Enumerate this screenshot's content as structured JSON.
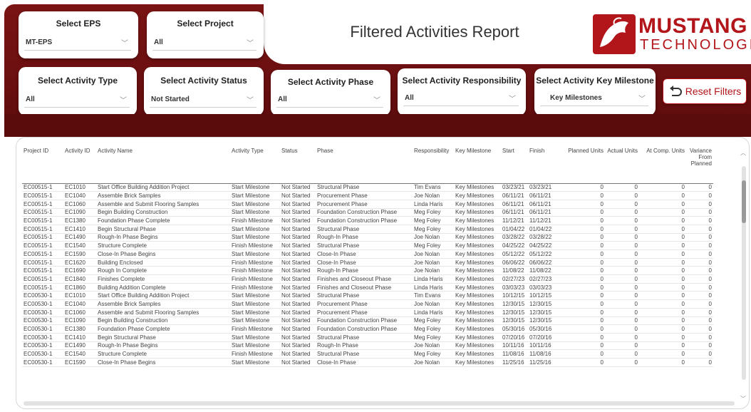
{
  "report_title": "Filtered Activities Report",
  "logo": {
    "brand": "MUSTANG",
    "sub": "TECHNOLOGIES"
  },
  "slicers": {
    "eps": {
      "title": "Select EPS",
      "value": "MT-EPS"
    },
    "project": {
      "title": "Select Project",
      "value": "All"
    },
    "activity_type": {
      "title": "Select Activity Type",
      "value": "All"
    },
    "activity_status": {
      "title": "Select Activity Status",
      "value": "Not Started"
    },
    "activity_phase": {
      "title": "Select Activity Phase",
      "value": "All"
    },
    "activity_responsibility": {
      "title": "Select Activity Responsibility",
      "value": "All"
    },
    "activity_key_milestone": {
      "title": "Select Activity Key Milestone",
      "value": "Key Milestones"
    }
  },
  "reset_label": "Reset Filters",
  "table": {
    "columns": [
      "Project ID",
      "Activity ID",
      "Activity Name",
      "Activity Type",
      "Status",
      "Phase",
      "Responsibility",
      "Key Milestone",
      "Start",
      "Finish",
      "Planned Units",
      "Actual Units",
      "At Comp. Units",
      "Variance From Planned"
    ],
    "rows": [
      [
        "EC00515-1",
        "EC1010",
        "Start Office Building Addition Project",
        "Start Milestone",
        "Not Started",
        "Structural Phase",
        "Tim Evans",
        "Key Milestones",
        "03/23/21",
        "03/23/21",
        "0",
        "0",
        "0",
        "0"
      ],
      [
        "EC00515-1",
        "EC1040",
        "Assemble Brick Samples",
        "Start Milestone",
        "Not Started",
        "Procurement Phase",
        "Joe Nolan",
        "Key Milestones",
        "06/11/21",
        "06/11/21",
        "0",
        "0",
        "0",
        "0"
      ],
      [
        "EC00515-1",
        "EC1060",
        "Assemble and Submit Flooring Samples",
        "Start Milestone",
        "Not Started",
        "Procurement Phase",
        "Linda Haris",
        "Key Milestones",
        "06/11/21",
        "06/11/21",
        "0",
        "0",
        "0",
        "0"
      ],
      [
        "EC00515-1",
        "EC1090",
        "Begin Building Construction",
        "Start Milestone",
        "Not Started",
        "Foundation Construction Phase",
        "Meg Foley",
        "Key Milestones",
        "06/11/21",
        "06/11/21",
        "0",
        "0",
        "0",
        "0"
      ],
      [
        "EC00515-1",
        "EC1380",
        "Foundation Phase Complete",
        "Finish Milestone",
        "Not Started",
        "Foundation Construction Phase",
        "Meg Foley",
        "Key Milestones",
        "11/12/21",
        "11/12/21",
        "0",
        "0",
        "0",
        "0"
      ],
      [
        "EC00515-1",
        "EC1410",
        "Begin Structural Phase",
        "Start Milestone",
        "Not Started",
        "Structural Phase",
        "Meg Foley",
        "Key Milestones",
        "01/04/22",
        "01/04/22",
        "0",
        "0",
        "0",
        "0"
      ],
      [
        "EC00515-1",
        "EC1490",
        "Rough-In Phase Begins",
        "Start Milestone",
        "Not Started",
        "Rough-In Phase",
        "Joe Nolan",
        "Key Milestones",
        "03/28/22",
        "03/28/22",
        "0",
        "0",
        "0",
        "0"
      ],
      [
        "EC00515-1",
        "EC1540",
        "Structure Complete",
        "Finish Milestone",
        "Not Started",
        "Structural Phase",
        "Meg Foley",
        "Key Milestones",
        "04/25/22",
        "04/25/22",
        "0",
        "0",
        "0",
        "0"
      ],
      [
        "EC00515-1",
        "EC1590",
        "Close-In Phase Begins",
        "Start Milestone",
        "Not Started",
        "Close-In Phase",
        "Joe Nolan",
        "Key Milestones",
        "05/12/22",
        "05/12/22",
        "0",
        "0",
        "0",
        "0"
      ],
      [
        "EC00515-1",
        "EC1620",
        "Building Enclosed",
        "Finish Milestone",
        "Not Started",
        "Close-In Phase",
        "Joe Nolan",
        "Key Milestones",
        "06/06/22",
        "06/06/22",
        "0",
        "0",
        "0",
        "0"
      ],
      [
        "EC00515-1",
        "EC1690",
        "Rough In Complete",
        "Finish Milestone",
        "Not Started",
        "Rough-In Phase",
        "Joe Nolan",
        "Key Milestones",
        "11/08/22",
        "11/08/22",
        "0",
        "0",
        "0",
        "0"
      ],
      [
        "EC00515-1",
        "EC1840",
        "Finishes Complete",
        "Finish Milestone",
        "Not Started",
        "Finishes and Closeout Phase",
        "Linda Haris",
        "Key Milestones",
        "02/27/23",
        "02/27/23",
        "0",
        "0",
        "0",
        "0"
      ],
      [
        "EC00515-1",
        "EC1860",
        "Building Addition Complete",
        "Finish Milestone",
        "Not Started",
        "Finishes and Closeout Phase",
        "Linda Haris",
        "Key Milestones",
        "03/03/23",
        "03/03/23",
        "0",
        "0",
        "0",
        "0"
      ],
      [
        "EC00530-1",
        "EC1010",
        "Start Office Building Addition Project",
        "Start Milestone",
        "Not Started",
        "Structural Phase",
        "Tim Evans",
        "Key Milestones",
        "10/12/15",
        "10/12/15",
        "0",
        "0",
        "0",
        "0"
      ],
      [
        "EC00530-1",
        "EC1040",
        "Assemble Brick Samples",
        "Start Milestone",
        "Not Started",
        "Procurement Phase",
        "Joe Nolan",
        "Key Milestones",
        "12/30/15",
        "12/30/15",
        "0",
        "0",
        "0",
        "0"
      ],
      [
        "EC00530-1",
        "EC1060",
        "Assemble and Submit Flooring Samples",
        "Start Milestone",
        "Not Started",
        "Procurement Phase",
        "Linda Haris",
        "Key Milestones",
        "12/30/15",
        "12/30/15",
        "0",
        "0",
        "0",
        "0"
      ],
      [
        "EC00530-1",
        "EC1090",
        "Begin Building Construction",
        "Start Milestone",
        "Not Started",
        "Foundation Construction Phase",
        "Meg Foley",
        "Key Milestones",
        "12/30/15",
        "12/30/15",
        "0",
        "0",
        "0",
        "0"
      ],
      [
        "EC00530-1",
        "EC1380",
        "Foundation Phase Complete",
        "Finish Milestone",
        "Not Started",
        "Foundation Construction Phase",
        "Meg Foley",
        "Key Milestones",
        "05/30/16",
        "05/30/16",
        "0",
        "0",
        "0",
        "0"
      ],
      [
        "EC00530-1",
        "EC1410",
        "Begin Structural Phase",
        "Start Milestone",
        "Not Started",
        "Structural Phase",
        "Meg Foley",
        "Key Milestones",
        "07/20/16",
        "07/20/16",
        "0",
        "0",
        "0",
        "0"
      ],
      [
        "EC00530-1",
        "EC1490",
        "Rough-In Phase Begins",
        "Start Milestone",
        "Not Started",
        "Rough-In Phase",
        "Joe Nolan",
        "Key Milestones",
        "10/11/16",
        "10/11/16",
        "0",
        "0",
        "0",
        "0"
      ],
      [
        "EC00530-1",
        "EC1540",
        "Structure Complete",
        "Finish Milestone",
        "Not Started",
        "Structural Phase",
        "Meg Foley",
        "Key Milestones",
        "11/08/16",
        "11/08/16",
        "0",
        "0",
        "0",
        "0"
      ],
      [
        "EC00530-1",
        "EC1590",
        "Close-In Phase Begins",
        "Start Milestone",
        "Not Started",
        "Close-In Phase",
        "Joe Nolan",
        "Key Milestones",
        "11/25/16",
        "11/25/16",
        "0",
        "0",
        "0",
        "0"
      ]
    ]
  },
  "colors": {
    "banner": "#6a0f10",
    "accent": "#b2151a"
  },
  "icons": {
    "dropdown": "chevron-down-icon",
    "reset": "undo-arrow-icon",
    "logo": "mustang-horse-icon"
  }
}
